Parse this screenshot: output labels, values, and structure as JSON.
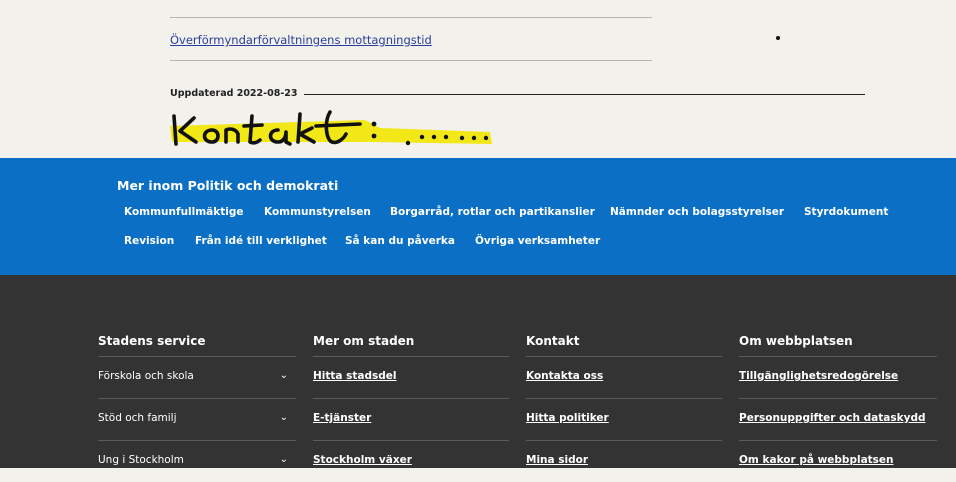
{
  "links": {
    "top_link": "Överförmyndarförvaltningens mottagningstid"
  },
  "meta": {
    "updated": "Uppdaterad 2022-08-23"
  },
  "handwriting": {
    "text": "Kontakt : ......"
  },
  "more_section": {
    "title": "Mer inom Politik och demokrati",
    "links": [
      "Kommunfullmäktige",
      "Kommunstyrelsen",
      "Borgarråd, rotlar och partikanslier",
      "Nämnder och bolagsstyrelser",
      "Styrdokument",
      "Revision",
      "Från idé till verklighet",
      "Så kan du påverka",
      "Övriga verksamheter"
    ]
  },
  "footer": {
    "columns": [
      {
        "heading": "Stadens service",
        "items": [
          "Förskola och skola",
          "Stöd och familj",
          "Ung i Stockholm"
        ]
      },
      {
        "heading": "Mer om staden",
        "items": [
          "Hitta stadsdel",
          "E-tjänster",
          "Stockholm växer"
        ]
      },
      {
        "heading": "Kontakt",
        "items": [
          "Kontakta oss",
          "Hitta politiker",
          "Mina sidor"
        ]
      },
      {
        "heading": "Om webbplatsen",
        "items": [
          "Tillgänglighetsredogörelse",
          "Personuppgifter och dataskydd",
          "Om kakor på webbplatsen"
        ]
      }
    ]
  },
  "colors": {
    "background": "#f3f1ec",
    "blue_band": "#0a6fc5",
    "footer": "#333333",
    "link": "#2a3e99",
    "highlighter": "#f2e600"
  },
  "icons": {
    "expand": "chevron-down-icon"
  }
}
